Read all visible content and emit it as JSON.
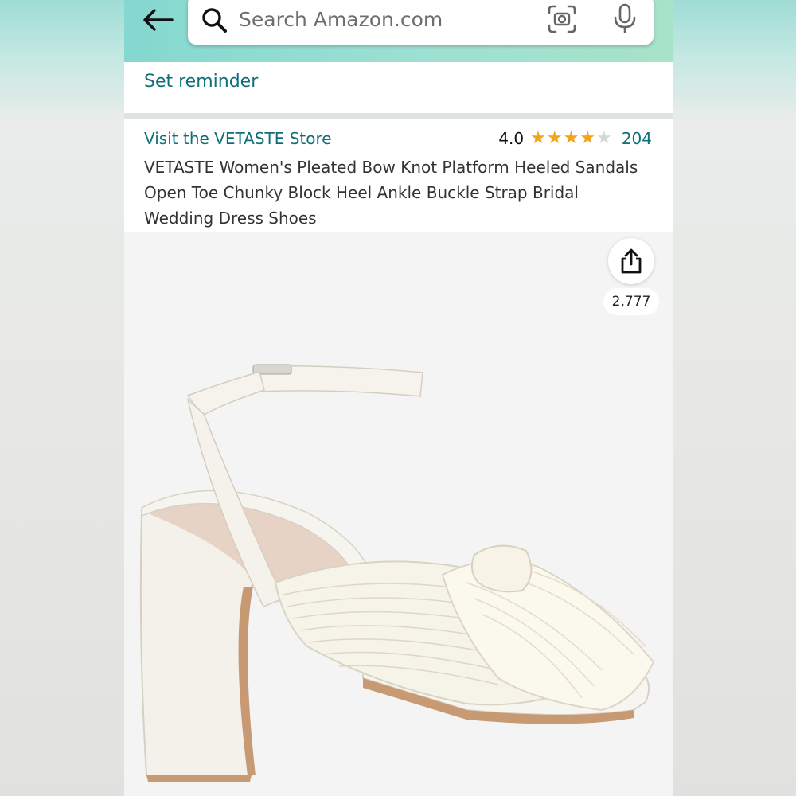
{
  "header": {
    "search_placeholder": "Search Amazon.com"
  },
  "reminder": {
    "label": "Set reminder"
  },
  "product": {
    "store_link": "Visit the VETASTE Store",
    "rating": "4.0",
    "stars": 4,
    "max_stars": 5,
    "review_count": "204",
    "title": "VETASTE Women's Pleated Bow Knot Platform Heeled Sandals Open Toe Chunky Block Heel Ankle Buckle Strap Bridal Wedding Dress Shoes"
  },
  "gallery": {
    "share_count": "2,777"
  },
  "colors": {
    "link": "#0f6f79",
    "star": "#f2a41b",
    "header": "#9ee0d3"
  },
  "icons": {
    "back": "back-arrow-icon",
    "search": "search-icon",
    "camera": "camera-scan-icon",
    "mic": "microphone-icon",
    "share": "share-icon"
  }
}
